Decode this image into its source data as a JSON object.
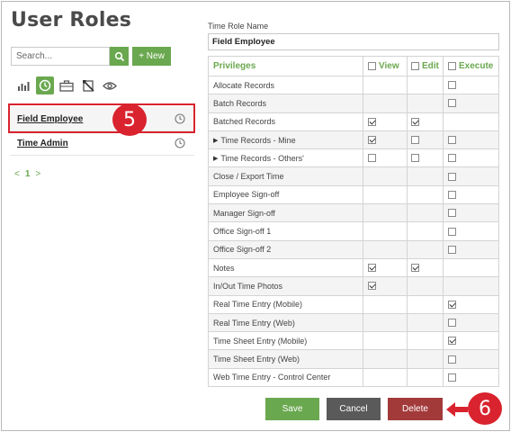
{
  "page": {
    "title": "User Roles"
  },
  "search": {
    "placeholder": "Search..."
  },
  "toolbar": {
    "new_label": "+ New"
  },
  "roles": [
    {
      "label": "Field Employee",
      "selected": true
    },
    {
      "label": "Time Admin",
      "selected": false
    }
  ],
  "pager": {
    "prev": "<",
    "page": "1",
    "next": ">"
  },
  "form": {
    "role_name_label": "Time Role Name",
    "role_name_value": "Field Employee"
  },
  "privileges": {
    "headers": {
      "name": "Privileges",
      "view": "View",
      "edit": "Edit",
      "execute": "Execute"
    },
    "rows": [
      {
        "name": "Allocate Records",
        "view": null,
        "edit": null,
        "execute": false
      },
      {
        "name": "Batch Records",
        "view": null,
        "edit": null,
        "execute": false
      },
      {
        "name": "Batched Records",
        "view": true,
        "edit": true,
        "execute": null
      },
      {
        "name": "Time Records - Mine",
        "expandable": true,
        "view": true,
        "edit": false,
        "execute": false
      },
      {
        "name": "Time Records - Others'",
        "expandable": true,
        "view": false,
        "edit": false,
        "execute": false
      },
      {
        "name": "Close / Export Time",
        "view": null,
        "edit": null,
        "execute": false
      },
      {
        "name": "Employee Sign-off",
        "view": null,
        "edit": null,
        "execute": false
      },
      {
        "name": "Manager Sign-off",
        "view": null,
        "edit": null,
        "execute": false
      },
      {
        "name": "Office Sign-off 1",
        "view": null,
        "edit": null,
        "execute": false
      },
      {
        "name": "Office Sign-off 2",
        "view": null,
        "edit": null,
        "execute": false
      },
      {
        "name": "Notes",
        "view": true,
        "edit": true,
        "execute": null
      },
      {
        "name": "In/Out Time Photos",
        "view": true,
        "edit": null,
        "execute": null
      },
      {
        "name": "Real Time Entry (Mobile)",
        "view": null,
        "edit": null,
        "execute": true
      },
      {
        "name": "Real Time Entry (Web)",
        "view": null,
        "edit": null,
        "execute": false
      },
      {
        "name": "Time Sheet Entry (Mobile)",
        "view": null,
        "edit": null,
        "execute": true
      },
      {
        "name": "Time Sheet Entry (Web)",
        "view": null,
        "edit": null,
        "execute": false
      },
      {
        "name": "Web Time Entry - Control Center",
        "view": null,
        "edit": null,
        "execute": false
      }
    ]
  },
  "buttons": {
    "save": "Save",
    "cancel": "Cancel",
    "delete": "Delete"
  },
  "callouts": {
    "role": "5",
    "delete": "6"
  },
  "colors": {
    "accent": "#6aa84f",
    "danger": "#a33a3a",
    "callout": "#d9232e",
    "neutral": "#5a5a5a"
  }
}
